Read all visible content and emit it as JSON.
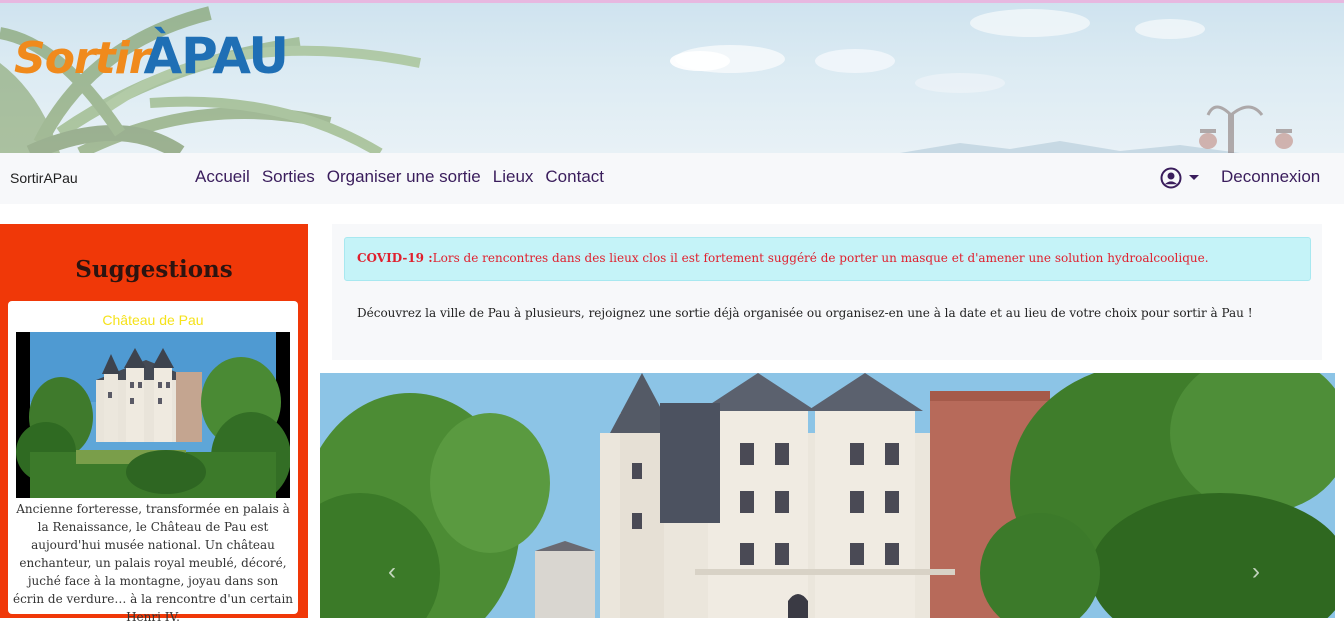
{
  "banner": {
    "logo_part1": "Sortir",
    "logo_part2": "ÀPAU"
  },
  "navbar": {
    "brand": "SortirAPau",
    "links": [
      "Accueil",
      "Sorties",
      "Organiser une sortie",
      "Lieux",
      "Contact"
    ],
    "user_icon": "user-circle-icon",
    "logout": "Deconnexion"
  },
  "sidebar": {
    "title": "Suggestions",
    "card": {
      "title": "Château de Pau",
      "description": "Ancienne forteresse, transformée en palais à la Renaissance, le Château de Pau est aujourd'hui musée national. Un château enchanteur, un palais royal meublé, décoré, juché face à la montagne, joyau dans son écrin de verdure… à la rencontre d'un certain Henri IV."
    }
  },
  "main": {
    "alert_label": "COVID-19 :",
    "alert_text": "Lors de rencontres dans des lieux clos il est fortement suggéré de porter un masque et d'amener une solution hydroalcoolique.",
    "intro": "Découvrez la ville de Pau à plusieurs, rejoignez une sortie déjà organisée ou organisez-en une à la date et au lieu de votre choix pour sortir à Pau !"
  },
  "carousel": {
    "prev_icon": "chevron-left-icon",
    "next_icon": "chevron-right-icon"
  },
  "colors": {
    "sidebar_bg": "#f03808",
    "nav_text": "#3a1d5c",
    "alert_bg": "#c5f3f8",
    "alert_text": "#e0202e",
    "card_title": "#f5e21b"
  }
}
